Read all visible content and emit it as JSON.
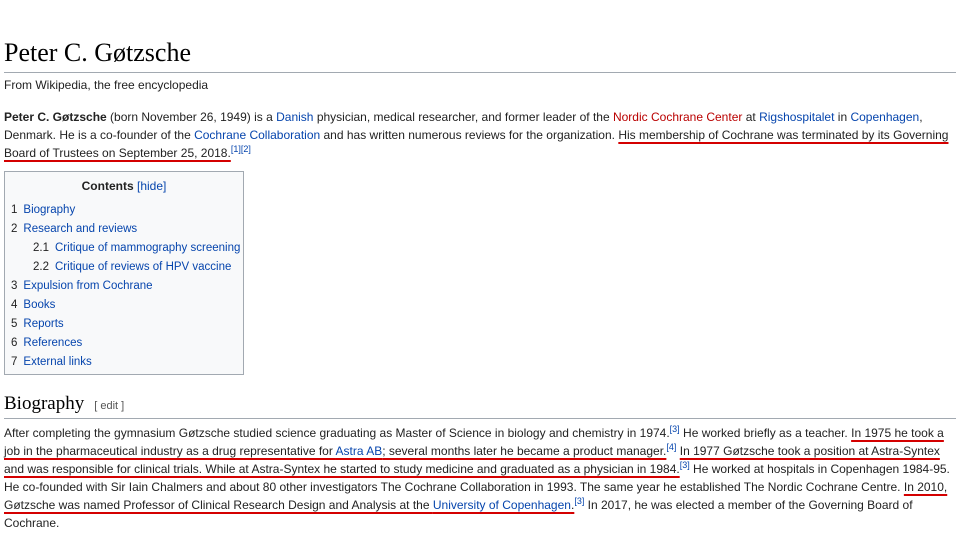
{
  "article": {
    "title": "Peter C. Gøtzsche",
    "from": "From Wikipedia, the free encyclopedia"
  },
  "lead": {
    "name": "Peter C. Gøtzsche",
    "t1": " (born November 26, 1949) is a ",
    "link_danish": "Danish",
    "t2": " physician, medical researcher, and former leader of the ",
    "link_nordic": "Nordic Cochrane Center",
    "t3": " at ",
    "link_rigs": "Rigshospitalet",
    "t4": " in ",
    "link_cph": "Copenhagen",
    "t5": ", Denmark. He is a co-founder of the ",
    "link_collab": "Cochrane Collaboration",
    "t6": " and has written numerous reviews for the organization. ",
    "underlined": "His membership of Cochrane was terminated by its Governing Board of Trustees on September 25, 2018.",
    "cite": "[1][2]"
  },
  "toc": {
    "title": "Contents",
    "hide": "[hide]",
    "items": [
      {
        "num": "1",
        "label": "Biography"
      },
      {
        "num": "2",
        "label": "Research and reviews"
      },
      {
        "num": "2.1",
        "label": "Critique of mammography screening"
      },
      {
        "num": "2.2",
        "label": "Critique of reviews of HPV vaccine"
      },
      {
        "num": "3",
        "label": "Expulsion from Cochrane"
      },
      {
        "num": "4",
        "label": "Books"
      },
      {
        "num": "5",
        "label": "Reports"
      },
      {
        "num": "6",
        "label": "References"
      },
      {
        "num": "7",
        "label": "External links"
      }
    ]
  },
  "biography": {
    "heading": "Biography",
    "edit": "[ edit ]",
    "s1": "After completing the gymnasium Gøtzsche studied science graduating as Master of Science in biology and chemistry in 1974.",
    "c1": "[3]",
    "s2": " He worked briefly as a teacher. ",
    "u1": "In 1975 he took a job in the pharmaceutical industry as a drug representative for ",
    "link_astra": "Astra AB",
    "u1b": "; several months later he became a product manager.",
    "c2": "[4]",
    "s3": " ",
    "u2": "In 1977 Gøtzsche took a position at Astra-Syntex and was responsible for clinical trials. While at Astra-Syntex he started to study medicine and graduated as a physician in 1984.",
    "c3": "[3]",
    "s4": " He worked at hospitals in Copenhagen 1984-95. He co-founded with Sir Iain Chalmers and about 80 other investigators The Cochrane Collaboration in 1993. The same year he established The Nordic Cochrane Centre. ",
    "u3": "In 2010, Gøtzsche was named Professor of Clinical Research Design and Analysis at the ",
    "link_uni": "University of Copenhagen",
    "u3b": ".",
    "c4": "[3]",
    "s5": " In 2017, he was elected a member of the Governing Board of Cochrane."
  }
}
